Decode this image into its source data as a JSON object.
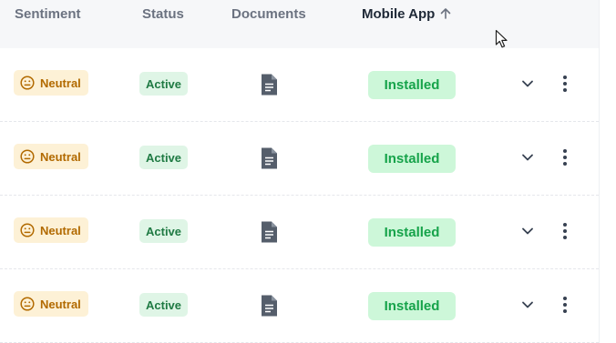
{
  "header": {
    "sentiment": "Sentiment",
    "status": "Status",
    "documents": "Documents",
    "mobile_app": "Mobile App",
    "sort_icon": "arrow-up-icon"
  },
  "rows": [
    {
      "sentiment": "Neutral",
      "status": "Active",
      "mobile_app": "Installed"
    },
    {
      "sentiment": "Neutral",
      "status": "Active",
      "mobile_app": "Installed"
    },
    {
      "sentiment": "Neutral",
      "status": "Active",
      "mobile_app": "Installed"
    },
    {
      "sentiment": "Neutral",
      "status": "Active",
      "mobile_app": "Installed"
    }
  ],
  "icons": {
    "sentiment": "neutral-face-icon",
    "document": "document-icon",
    "expand": "chevron-down-icon",
    "more": "more-vertical-icon",
    "cursor": "mouse-pointer-icon"
  },
  "colors": {
    "neutral_bg": "#fdf1d6",
    "neutral_text": "#b26a00",
    "active_bg": "#dff5e6",
    "active_text": "#1f7a43",
    "installed_bg": "#cdf7d9",
    "installed_text": "#16a34a",
    "header_bg": "#f6f7f9"
  }
}
